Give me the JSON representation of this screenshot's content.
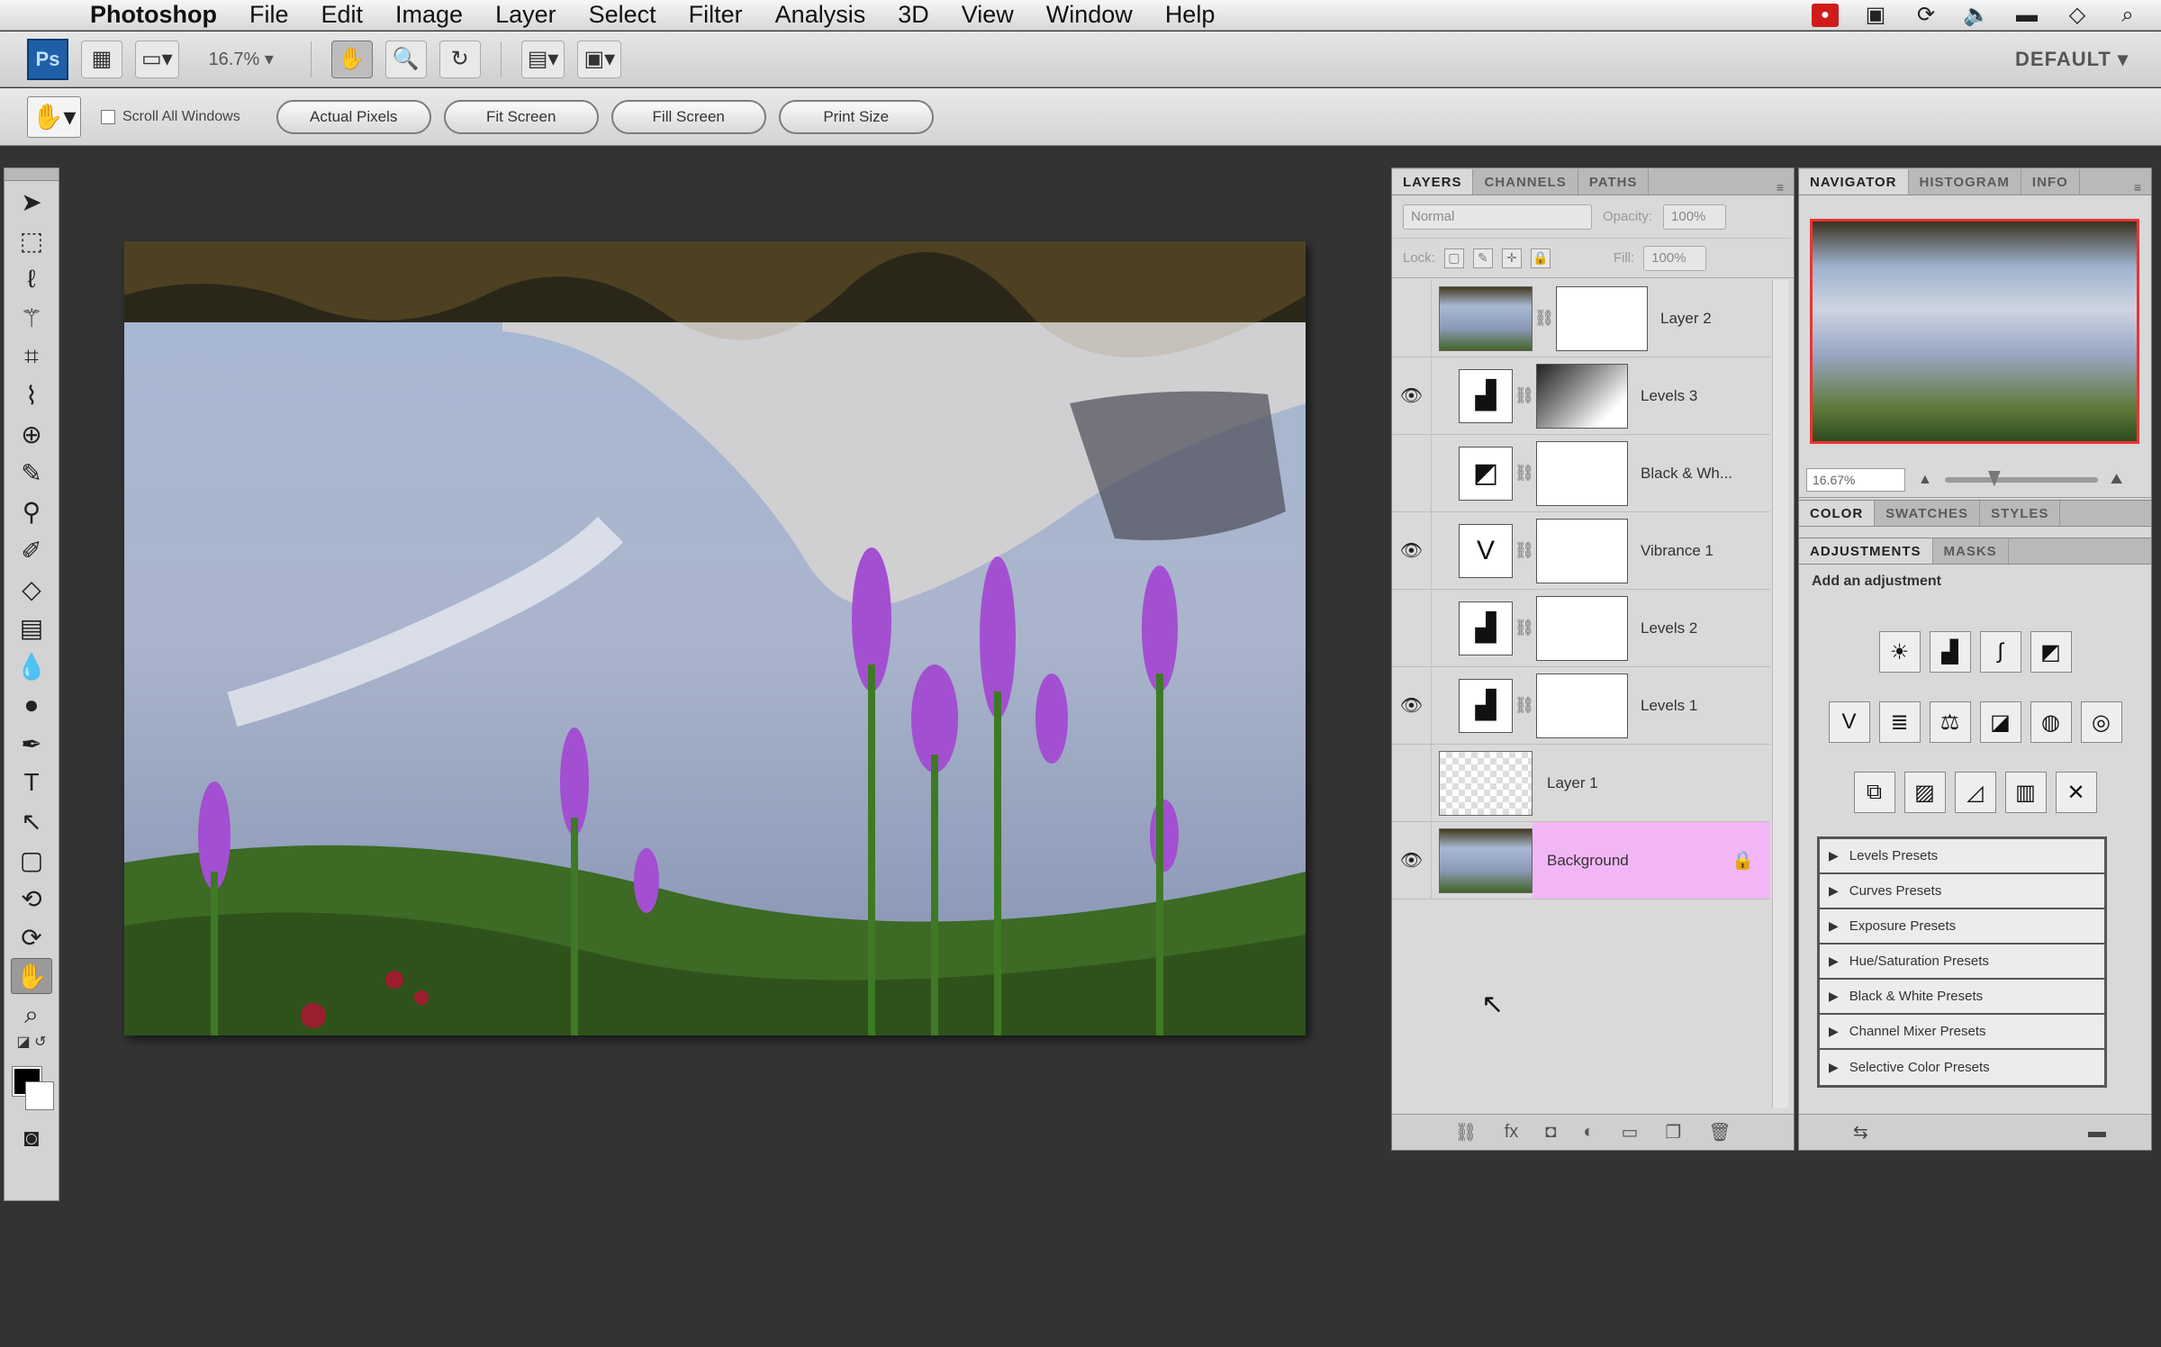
{
  "menubar": {
    "app_name": "Photoshop",
    "items": [
      "File",
      "Edit",
      "Image",
      "Layer",
      "Select",
      "Filter",
      "Analysis",
      "3D",
      "View",
      "Window",
      "Help"
    ]
  },
  "appbar": {
    "logo": "Ps",
    "zoom": "16.7%",
    "workspace": "DEFAULT"
  },
  "options": {
    "checkbox_label": "Scroll All Windows",
    "buttons": [
      "Actual Pixels",
      "Fit Screen",
      "Fill Screen",
      "Print Size"
    ]
  },
  "layers_panel": {
    "tabs": [
      "LAYERS",
      "CHANNELS",
      "PATHS"
    ],
    "blend_mode": "Normal",
    "opacity_label": "Opacity:",
    "opacity_value": "100%",
    "lock_label": "Lock:",
    "fill_label": "Fill:",
    "fill_value": "100%",
    "layers": [
      {
        "name": "Layer 2",
        "visible": false,
        "kind": "photo-mask",
        "selected": false
      },
      {
        "name": "Levels 3",
        "visible": true,
        "kind": "levels-grad",
        "selected": false
      },
      {
        "name": "Black & Wh...",
        "visible": false,
        "kind": "bw",
        "selected": false
      },
      {
        "name": "Vibrance 1",
        "visible": true,
        "kind": "vibrance",
        "selected": false
      },
      {
        "name": "Levels 2",
        "visible": false,
        "kind": "levels",
        "selected": false
      },
      {
        "name": "Levels 1",
        "visible": true,
        "kind": "levels",
        "selected": false
      },
      {
        "name": "Layer 1",
        "visible": false,
        "kind": "transparent",
        "selected": false
      },
      {
        "name": "Background",
        "visible": true,
        "kind": "photo",
        "selected": true
      }
    ]
  },
  "navigator": {
    "tabs": [
      "NAVIGATOR",
      "HISTOGRAM",
      "INFO"
    ],
    "zoom": "16.67%"
  },
  "color_tabs": [
    "COLOR",
    "SWATCHES",
    "STYLES"
  ],
  "adjustments": {
    "tabs": [
      "ADJUSTMENTS",
      "MASKS"
    ],
    "title": "Add an adjustment",
    "presets": [
      "Levels Presets",
      "Curves Presets",
      "Exposure Presets",
      "Hue/Saturation Presets",
      "Black & White Presets",
      "Channel Mixer Presets",
      "Selective Color Presets"
    ]
  }
}
